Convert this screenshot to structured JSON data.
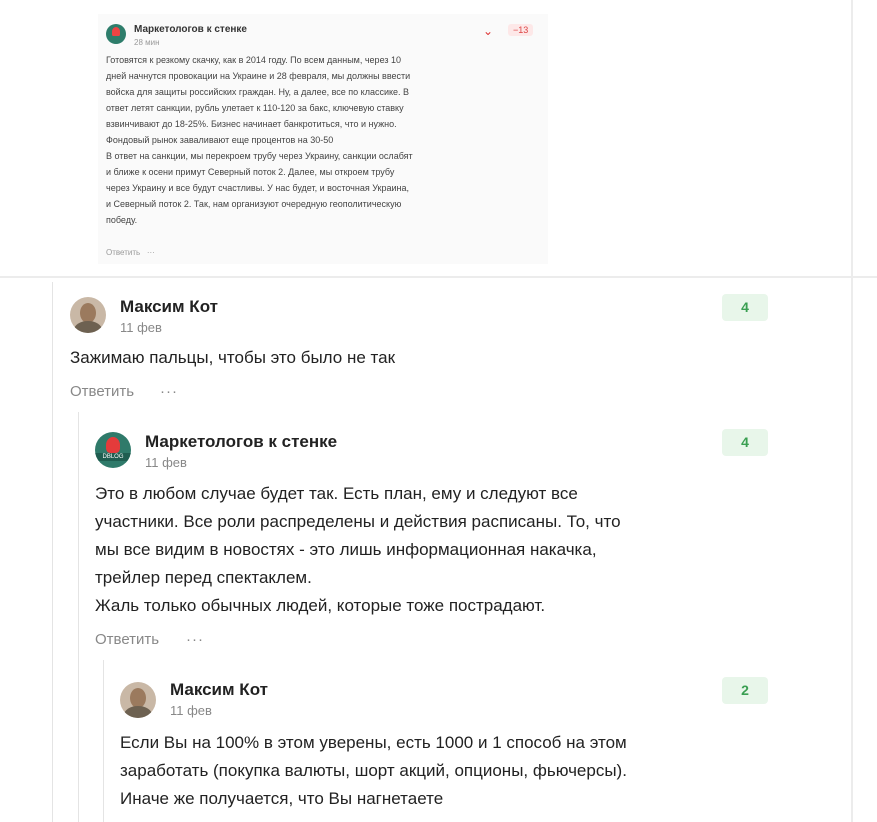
{
  "quoted": {
    "author": "Маркетологов к стенке",
    "time": "28 мин",
    "score": "−13",
    "lines": [
      "Готовятся к резкому скачку, как в 2014 году. По всем данным, через 10",
      "дней начнутся провокации на Украине и 28 февраля, мы должны ввести",
      "войска для защиты российских граждан. Ну, а далее, все по классике. В",
      "ответ летят санкции, рубль улетает к 110-120 за бакс, ключевую ставку",
      "взвинчивают до 18-25%. Бизнес начинает банкротиться, что и нужно.",
      "Фондовый рынок заваливают еще процентов на 30-50",
      "В ответ на санкции, мы перекроем трубу через Украину, санкции ослабят",
      "и ближе к осени примут Северный поток 2. Далее, мы откроем трубу",
      "через Украину и все будут счастливы. У нас будет, и восточная Украина,",
      "и Северный поток 2. Так, нам организуют очередную геополитическую",
      "победу."
    ],
    "reply_label": "Ответить",
    "more_label": "···"
  },
  "comments": [
    {
      "author": "Максим Кот",
      "date": "11 фев",
      "score": "4",
      "text": [
        "Зажимаю пальцы, чтобы это было не так"
      ],
      "reply_label": "Ответить",
      "more_label": "···"
    },
    {
      "author": "Маркетологов к стенке",
      "avatar_text": "DBLOG",
      "date": "11 фев",
      "score": "4",
      "text": [
        "Это в любом случае будет так. Есть план, ему и следуют все",
        "участники. Все роли распределены и действия расписаны. То, что",
        "мы все видим в новостях - это лишь информационная накачка,",
        "трейлер перед спектаклем.",
        "Жаль только обычных людей, которые тоже пострадают."
      ],
      "reply_label": "Ответить",
      "more_label": "···"
    },
    {
      "author": "Максим Кот",
      "date": "11 фев",
      "score": "2",
      "text": [
        "Если Вы на 100% в этом уверены, есть 1000 и 1 способ на этом",
        "заработать (покупка валюты, шорт акций, опционы, фьючерсы).",
        "Иначе же получается, что Вы нагнетаете"
      ]
    }
  ],
  "colors": {
    "score_bg": "#e8f6ea",
    "score_fg": "#3a9f52",
    "negative": "#dd3333"
  }
}
